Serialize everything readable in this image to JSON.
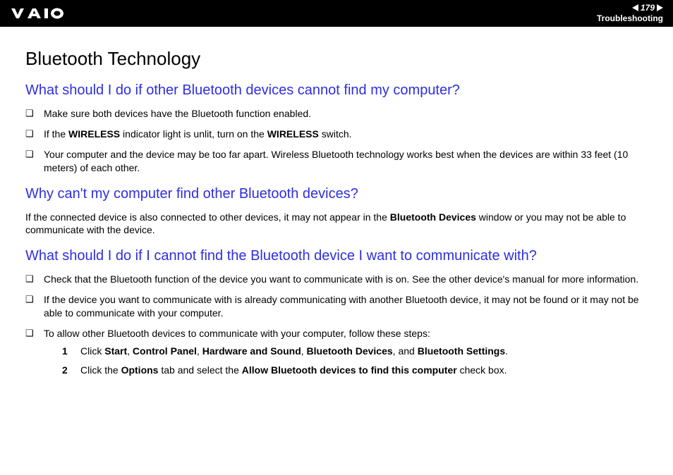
{
  "header": {
    "page_number": "179",
    "breadcrumb": "Troubleshooting"
  },
  "page_title": "Bluetooth Technology",
  "sections": [
    {
      "heading": "What should I do if other Bluetooth devices cannot find my computer?",
      "bullets": [
        {
          "html": "Make sure both devices have the Bluetooth function enabled."
        },
        {
          "html": "If the <b>WIRELESS</b> indicator light is unlit, turn on the <b>WIRELESS</b> switch."
        },
        {
          "html": "Your computer and the device may be too far apart. Wireless Bluetooth technology works best when the devices are within 33 feet (10 meters) of each other."
        }
      ]
    },
    {
      "heading": "Why can't my computer find other Bluetooth devices?",
      "para_html": "If the connected device is also connected to other devices, it may not appear in the <b>Bluetooth Devices</b> window or you may not be able to communicate with the device."
    },
    {
      "heading": "What should I do if I cannot find the Bluetooth device I want to communicate with?",
      "bullets": [
        {
          "html": "Check that the Bluetooth function of the device you want to communicate with is on. See the other device's manual for more information."
        },
        {
          "html": "If the device you want to communicate with is already communicating with another Bluetooth device, it may not be found or it may not be able to communicate with your computer."
        },
        {
          "html": "To allow other Bluetooth devices to communicate with your computer, follow these steps:",
          "steps": [
            {
              "num": "1",
              "html": "Click <b>Start</b>, <b>Control Panel</b>, <b>Hardware and Sound</b>, <b>Bluetooth Devices</b>, and <b>Bluetooth Settings</b>."
            },
            {
              "num": "2",
              "html": "Click the <b>Options</b> tab and select the <b>Allow Bluetooth devices to find this computer</b> check box."
            }
          ]
        }
      ]
    }
  ]
}
